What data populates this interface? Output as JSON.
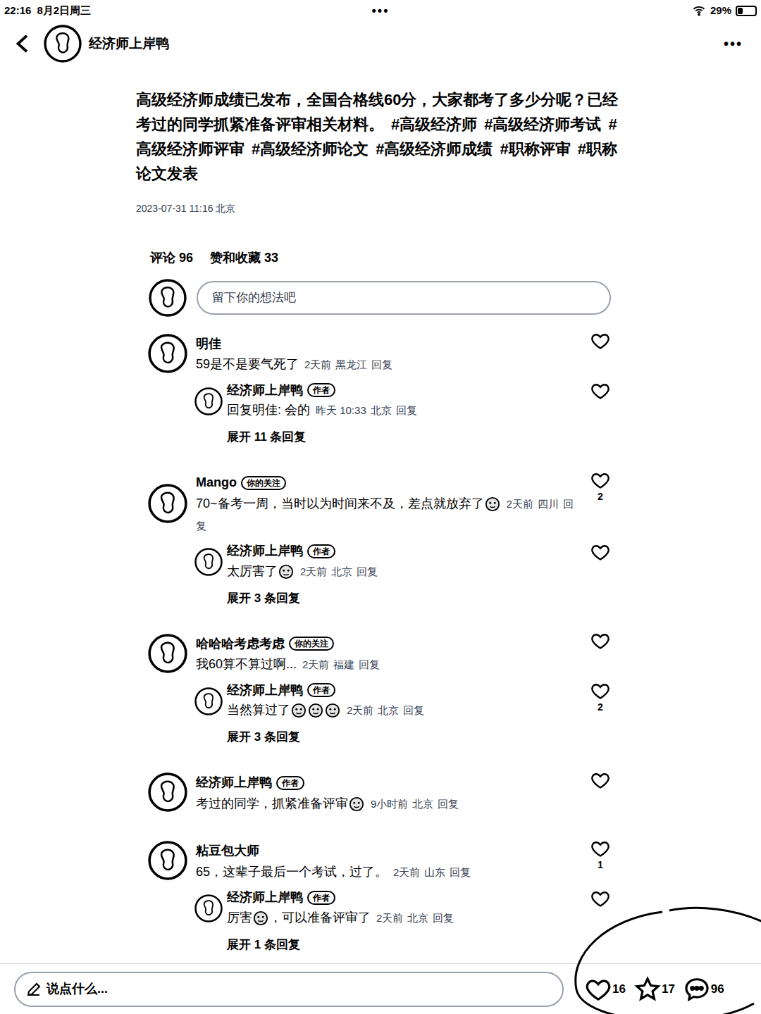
{
  "status_bar": {
    "time": "22:16",
    "date": "8月2日周三",
    "dots": "•••",
    "battery": "29%",
    "battery_level": 0.29
  },
  "header": {
    "title": "经济师上岸鸭",
    "more": "•••"
  },
  "post": {
    "text": "高级经济师成绩已发布，全国合格线60分，大家都考了多少分呢？已经考过的同学抓紧准备评审相关材料。",
    "tags": [
      "#高级经济师",
      "#高级经济师考试",
      "#高级经济师评审",
      "#高级经济师论文",
      "#高级经济师成绩",
      "#职称评审",
      "#职称论文发表"
    ],
    "date": "2023-07-31 11:16 北京"
  },
  "stats": [
    "评论 96",
    "赞和收藏 33"
  ],
  "comment_box": {
    "placeholder": "留下你的想法吧"
  },
  "comments": [
    {
      "user": "明佳",
      "segments": [
        {
          "kind": "text",
          "text": "59是不是要气死了"
        }
      ],
      "time": "2天前",
      "location": "黑龙江",
      "reply_label": "回复",
      "replies": [
        {
          "user": "经济师上岸鸭",
          "badge": "作者",
          "segments": [
            {
              "kind": "text",
              "text": "回复明佳: 会的"
            }
          ],
          "time": "昨天 10:33",
          "location": "北京",
          "reply_label": "回复"
        }
      ],
      "expand": "展开 11 条回复"
    },
    {
      "user": "Mango",
      "badge": "你的关注",
      "segments": [
        {
          "kind": "text",
          "text": "70~备考一周，当时以为时间来不及，差点就放弃了"
        },
        {
          "kind": "emoji"
        }
      ],
      "time": "2天前",
      "location": "四川",
      "reply_label": "回复",
      "likes": "2",
      "replies": [
        {
          "user": "经济师上岸鸭",
          "badge": "作者",
          "segments": [
            {
              "kind": "text",
              "text": "太厉害了"
            },
            {
              "kind": "emoji"
            }
          ],
          "time": "2天前",
          "location": "北京",
          "reply_label": "回复"
        }
      ],
      "expand": "展开 3 条回复"
    },
    {
      "user": "哈哈哈考虑考虑",
      "badge": "你的关注",
      "segments": [
        {
          "kind": "text",
          "text": "我60算不算过啊..."
        }
      ],
      "time": "2天前",
      "location": "福建",
      "reply_label": "回复",
      "replies": [
        {
          "user": "经济师上岸鸭",
          "badge": "作者",
          "segments": [
            {
              "kind": "text",
              "text": "当然算过了"
            },
            {
              "kind": "emoji"
            },
            {
              "kind": "emoji"
            },
            {
              "kind": "emoji"
            }
          ],
          "time": "2天前",
          "location": "北京",
          "reply_label": "回复",
          "likes": "2"
        }
      ],
      "expand": "展开 3 条回复"
    },
    {
      "user": "经济师上岸鸭",
      "badge": "作者",
      "segments": [
        {
          "kind": "text",
          "text": "考过的同学，抓紧准备评审"
        },
        {
          "kind": "emoji"
        }
      ],
      "time": "9小时前",
      "location": "北京",
      "reply_label": "回复",
      "replies": []
    },
    {
      "user": "粘豆包大师",
      "segments": [
        {
          "kind": "text",
          "text": "65，这辈子最后一个考试，过了。"
        }
      ],
      "time": "2天前",
      "location": "山东",
      "reply_label": "回复",
      "likes": "1",
      "replies": [
        {
          "user": "经济师上岸鸭",
          "badge": "作者",
          "segments": [
            {
              "kind": "text",
              "text": "厉害"
            },
            {
              "kind": "emoji"
            },
            {
              "kind": "text",
              "text": "，可以准备评审了"
            }
          ],
          "time": "2天前",
          "location": "北京",
          "reply_label": "回复"
        }
      ],
      "expand": "展开 1 条回复"
    }
  ],
  "bottom_bar": {
    "placeholder": "说点什么...",
    "likes": "16",
    "stars": "17",
    "comments": "96"
  }
}
